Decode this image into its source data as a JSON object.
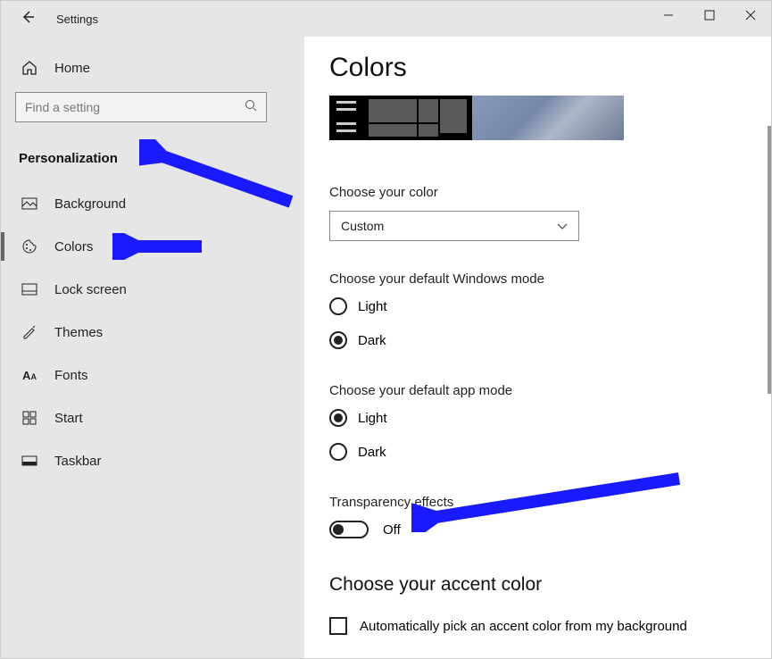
{
  "app": {
    "title": "Settings"
  },
  "sidebar": {
    "home_label": "Home",
    "search_placeholder": "Find a setting",
    "category": "Personalization",
    "items": [
      {
        "label": "Background"
      },
      {
        "label": "Colors"
      },
      {
        "label": "Lock screen"
      },
      {
        "label": "Themes"
      },
      {
        "label": "Fonts"
      },
      {
        "label": "Start"
      },
      {
        "label": "Taskbar"
      }
    ]
  },
  "main": {
    "title": "Colors",
    "choose_color_label": "Choose your color",
    "choose_color_value": "Custom",
    "windows_mode_label": "Choose your default Windows mode",
    "windows_mode_light": "Light",
    "windows_mode_dark": "Dark",
    "windows_mode_selected": "Dark",
    "app_mode_label": "Choose your default app mode",
    "app_mode_light": "Light",
    "app_mode_dark": "Dark",
    "app_mode_selected": "Light",
    "transparency_label": "Transparency effects",
    "transparency_state": "Off",
    "accent_heading": "Choose your accent color",
    "accent_auto_label": "Automatically pick an accent color from my background"
  }
}
